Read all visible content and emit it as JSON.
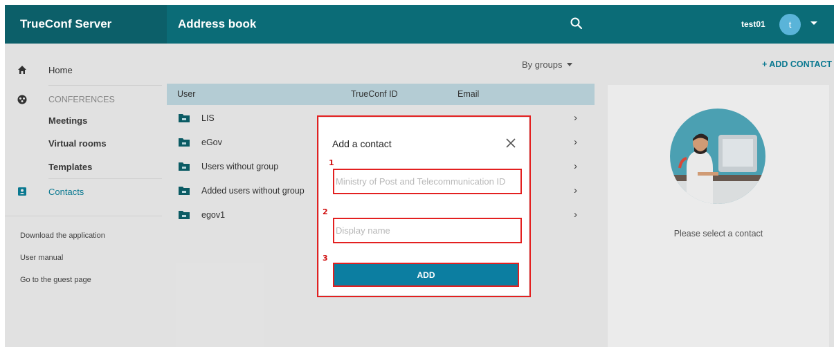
{
  "app": {
    "brand": "TrueConf Server",
    "title": "Address book",
    "username": "test01",
    "avatar_letter": "t"
  },
  "sidebar": {
    "home": "Home",
    "conferences_title": "CONFERENCES",
    "conference_items": [
      "Meetings",
      "Virtual rooms",
      "Templates"
    ],
    "contacts": "Contacts",
    "links": [
      "Download the application",
      "User manual",
      "Go to the guest page"
    ]
  },
  "toolbar": {
    "group_mode": "By groups",
    "add_contact": "+ ADD CONTACT"
  },
  "list": {
    "columns": [
      "User",
      "TrueConf ID",
      "Email"
    ],
    "groups": [
      "LIS",
      "eGov",
      "Users without group",
      "Added users without group",
      "egov1"
    ]
  },
  "detail": {
    "empty_text": "Please select a contact"
  },
  "modal": {
    "title": "Add a contact",
    "markers": [
      "1",
      "2",
      "3"
    ],
    "id_placeholder": "Ministry of Post and Telecommunication ID",
    "name_placeholder": "Display name",
    "add_label": "ADD"
  },
  "colors": {
    "header": "#0b6c77",
    "brand_bg": "#0c5f69",
    "accent": "#0a7d96",
    "button": "#0c7ea1",
    "highlight": "#e32020"
  }
}
